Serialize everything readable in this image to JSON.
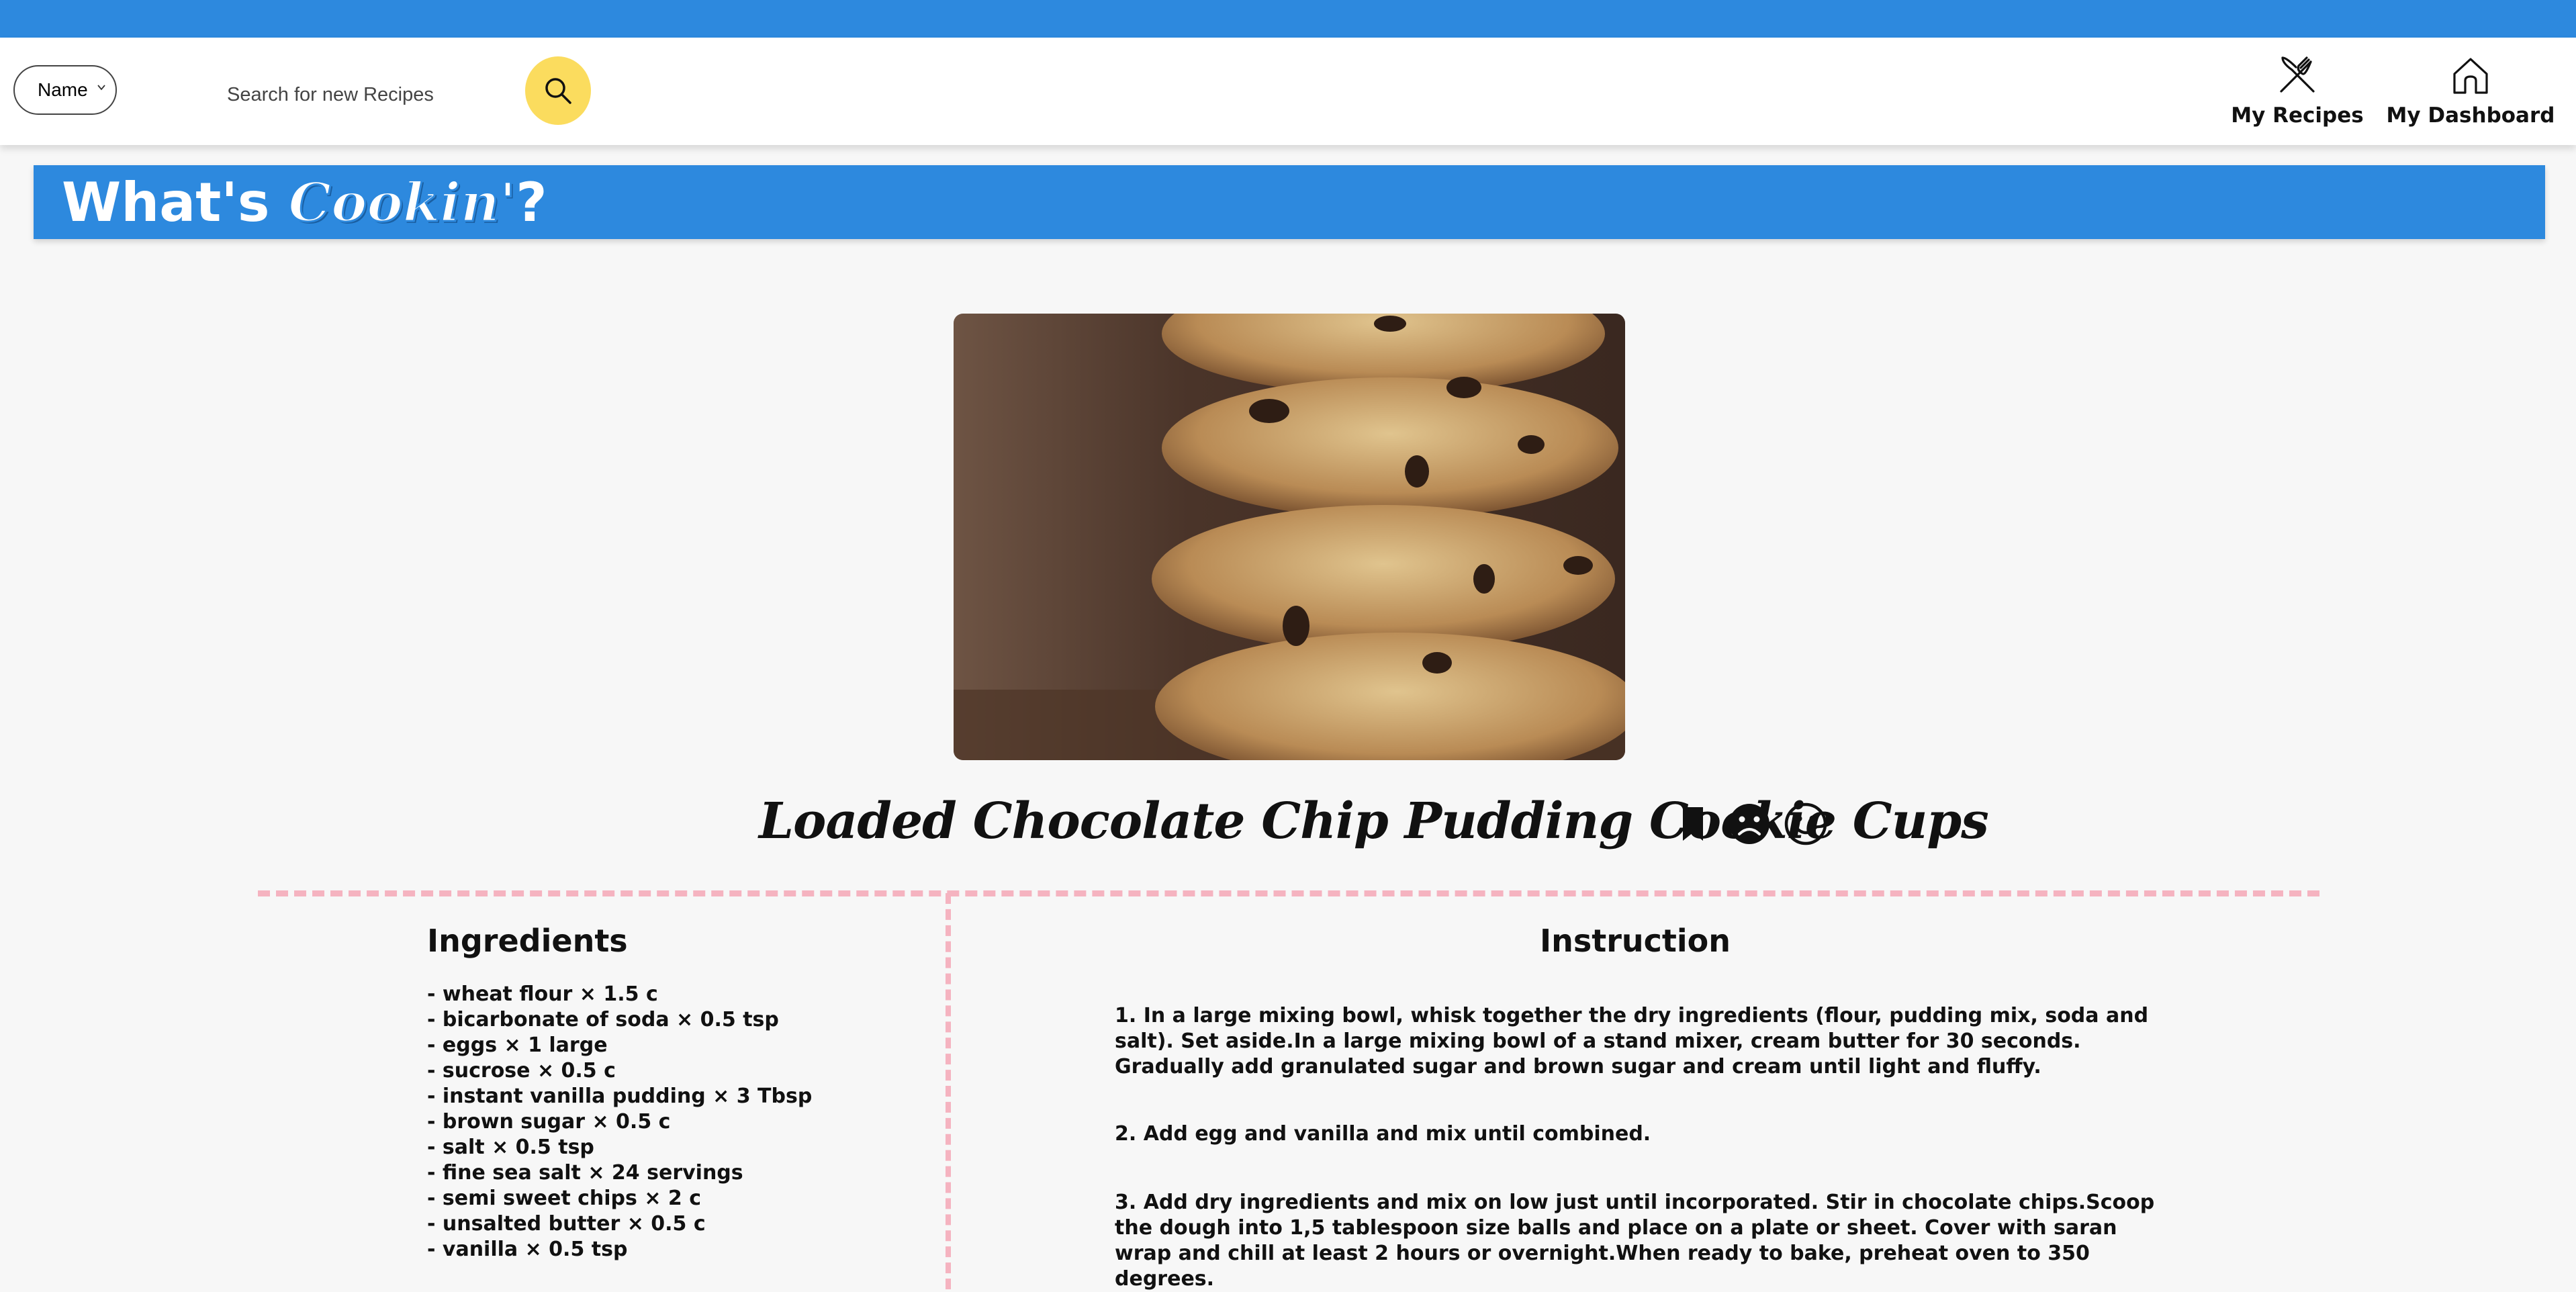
{
  "header": {
    "search_type": {
      "value": "Name",
      "options": [
        "Name"
      ]
    },
    "search": {
      "placeholder": "Search for new Recipes"
    },
    "search_button_icon": "magnifier-icon",
    "nav": [
      {
        "label": "My Recipes",
        "icon": "fork-knife-icon"
      },
      {
        "label": "My Dashboard",
        "icon": "home-icon"
      }
    ]
  },
  "banner": {
    "title_prefix": "What's ",
    "title_script": "Cookin'",
    "title_suffix": "?"
  },
  "recipe": {
    "image": "cookie-stack-photo",
    "title": "Loaded Chocolate Chip Pudding Cookie Cups",
    "actions": [
      "bookmark-icon",
      "sad-face-icon",
      "smiley-face-icon"
    ],
    "ingredients_heading": "Ingredients",
    "ingredients": [
      "- wheat flour × 1.5 c",
      "- bicarbonate of soda × 0.5 tsp",
      "- eggs × 1 large",
      "- sucrose × 0.5 c",
      "- instant vanilla pudding × 3 Tbsp",
      "- brown sugar × 0.5 c",
      "- salt × 0.5 tsp",
      "- fine sea salt × 24 servings",
      "- semi sweet chips × 2 c",
      "- unsalted butter × 0.5 c",
      "- vanilla × 0.5 tsp"
    ],
    "instruction_heading": "Instruction",
    "steps": [
      "1. In a large mixing bowl, whisk together the dry ingredients (flour, pudding mix, soda and salt). Set aside.In a large mixing bowl of a stand mixer, cream butter for 30 seconds. Gradually add granulated sugar and brown sugar and cream until light and fluffy.",
      "2. Add egg and vanilla and mix until combined.",
      "3. Add dry ingredients and mix on low just until incorporated. Stir in chocolate chips.Scoop the dough into 1,5 tablespoon size balls and place on a plate or sheet. Cover with saran wrap and chill at least 2 hours or overnight.When ready to bake, preheat oven to 350 degrees."
    ]
  },
  "colors": {
    "brand_blue": "#2d89de",
    "search_button": "#fbdc5e",
    "divider_pink": "#f5b3c0",
    "page_bg": "#f7f7f7"
  }
}
